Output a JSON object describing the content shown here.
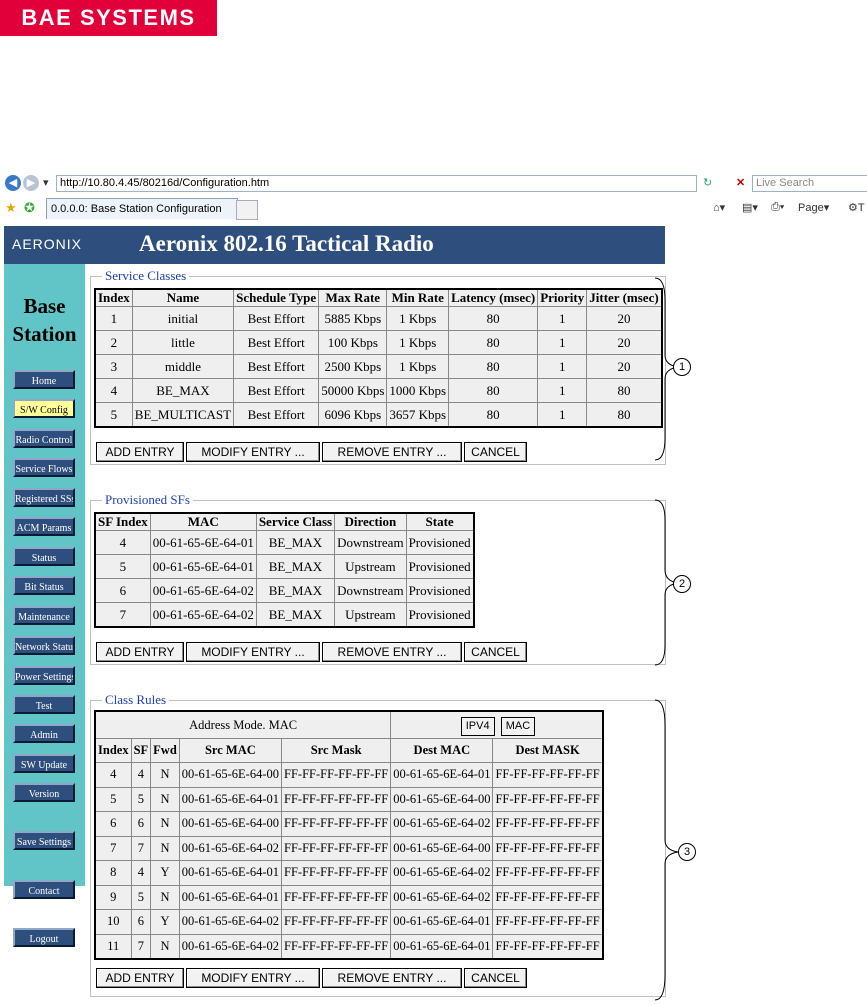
{
  "logo": {
    "text": "BAE SYSTEMS"
  },
  "browser": {
    "url": "http://10.80.4.45/80216d/Configuration.htm",
    "search_placeholder": "Live Search",
    "tab_title": "0.0.0.0: Base Station Configuration",
    "page_menu": "Page"
  },
  "header": {
    "logo_text": "AERONIX",
    "title": "Aeronix 802.16 Tactical Radio"
  },
  "sidebar": {
    "title_line1": "Base",
    "title_line2": "Station",
    "items": [
      {
        "label": "Home"
      },
      {
        "label": "S/W Config"
      },
      {
        "label": "Radio Control"
      },
      {
        "label": "Service Flows"
      },
      {
        "label": "Registered SSs"
      },
      {
        "label": "ACM Params"
      },
      {
        "label": "Status"
      },
      {
        "label": "Bit Status"
      },
      {
        "label": "Maintenance"
      },
      {
        "label": "Network Status"
      },
      {
        "label": "Power Settings"
      },
      {
        "label": "Test"
      },
      {
        "label": "Admin"
      },
      {
        "label": "SW Update"
      },
      {
        "label": "Version"
      },
      {
        "label": "Save Settings"
      },
      {
        "label": "Contact"
      },
      {
        "label": "Logout"
      }
    ]
  },
  "service_classes": {
    "legend": "Service Classes",
    "headers": [
      "Index",
      "Name",
      "Schedule Type",
      "Max Rate",
      "Min Rate",
      "Latency (msec)",
      "Priority",
      "Jitter (msec)"
    ],
    "rows": [
      [
        "1",
        "initial",
        "Best Effort",
        "5885 Kbps",
        "1 Kbps",
        "80",
        "1",
        "20"
      ],
      [
        "2",
        "little",
        "Best Effort",
        "100 Kbps",
        "1 Kbps",
        "80",
        "1",
        "20"
      ],
      [
        "3",
        "middle",
        "Best Effort",
        "2500 Kbps",
        "1 Kbps",
        "80",
        "1",
        "20"
      ],
      [
        "4",
        "BE_MAX",
        "Best Effort",
        "50000 Kbps",
        "1000 Kbps",
        "80",
        "1",
        "80"
      ],
      [
        "5",
        "BE_MULTICAST",
        "Best Effort",
        "6096 Kbps",
        "3657 Kbps",
        "80",
        "1",
        "80"
      ]
    ],
    "callout": "1"
  },
  "provisioned_sfs": {
    "legend": "Provisioned SFs",
    "headers": [
      "SF Index",
      "MAC",
      "Service Class",
      "Direction",
      "State"
    ],
    "rows": [
      [
        "4",
        "00-61-65-6E-64-01",
        "BE_MAX",
        "Downstream",
        "Provisioned"
      ],
      [
        "5",
        "00-61-65-6E-64-01",
        "BE_MAX",
        "Upstream",
        "Provisioned"
      ],
      [
        "6",
        "00-61-65-6E-64-02",
        "BE_MAX",
        "Downstream",
        "Provisioned"
      ],
      [
        "7",
        "00-61-65-6E-64-02",
        "BE_MAX",
        "Upstream",
        "Provisioned"
      ]
    ],
    "callout": "2"
  },
  "class_rules": {
    "legend": "Class Rules",
    "address_mode": "Address Mode. MAC",
    "mode_buttons": [
      "IPV4",
      "MAC"
    ],
    "headers": [
      "Index",
      "SF",
      "Fwd",
      "Src MAC",
      "Src Mask",
      "Dest MAC",
      "Dest MASK"
    ],
    "rows": [
      [
        "4",
        "4",
        "N",
        "00-61-65-6E-64-00",
        "FF-FF-FF-FF-FF-FF",
        "00-61-65-6E-64-01",
        "FF-FF-FF-FF-FF-FF"
      ],
      [
        "5",
        "5",
        "N",
        "00-61-65-6E-64-01",
        "FF-FF-FF-FF-FF-FF",
        "00-61-65-6E-64-00",
        "FF-FF-FF-FF-FF-FF"
      ],
      [
        "6",
        "6",
        "N",
        "00-61-65-6E-64-00",
        "FF-FF-FF-FF-FF-FF",
        "00-61-65-6E-64-02",
        "FF-FF-FF-FF-FF-FF"
      ],
      [
        "7",
        "7",
        "N",
        "00-61-65-6E-64-02",
        "FF-FF-FF-FF-FF-FF",
        "00-61-65-6E-64-00",
        "FF-FF-FF-FF-FF-FF"
      ],
      [
        "8",
        "4",
        "Y",
        "00-61-65-6E-64-01",
        "FF-FF-FF-FF-FF-FF",
        "00-61-65-6E-64-02",
        "FF-FF-FF-FF-FF-FF"
      ],
      [
        "9",
        "5",
        "N",
        "00-61-65-6E-64-01",
        "FF-FF-FF-FF-FF-FF",
        "00-61-65-6E-64-02",
        "FF-FF-FF-FF-FF-FF"
      ],
      [
        "10",
        "6",
        "Y",
        "00-61-65-6E-64-02",
        "FF-FF-FF-FF-FF-FF",
        "00-61-65-6E-64-01",
        "FF-FF-FF-FF-FF-FF"
      ],
      [
        "11",
        "7",
        "N",
        "00-61-65-6E-64-02",
        "FF-FF-FF-FF-FF-FF",
        "00-61-65-6E-64-01",
        "FF-FF-FF-FF-FF-FF"
      ]
    ],
    "callout": "3"
  },
  "actions": {
    "add": "ADD ENTRY",
    "modify": "MODIFY ENTRY ...",
    "remove": "REMOVE ENTRY ...",
    "cancel": "CANCEL"
  },
  "colors": {
    "brand_red": "#e2003b",
    "header_blue": "#2e4f7d",
    "sidebar_teal": "#61c4c6",
    "active_nav": "#ffff99",
    "legend_blue": "#1f3fb3"
  }
}
